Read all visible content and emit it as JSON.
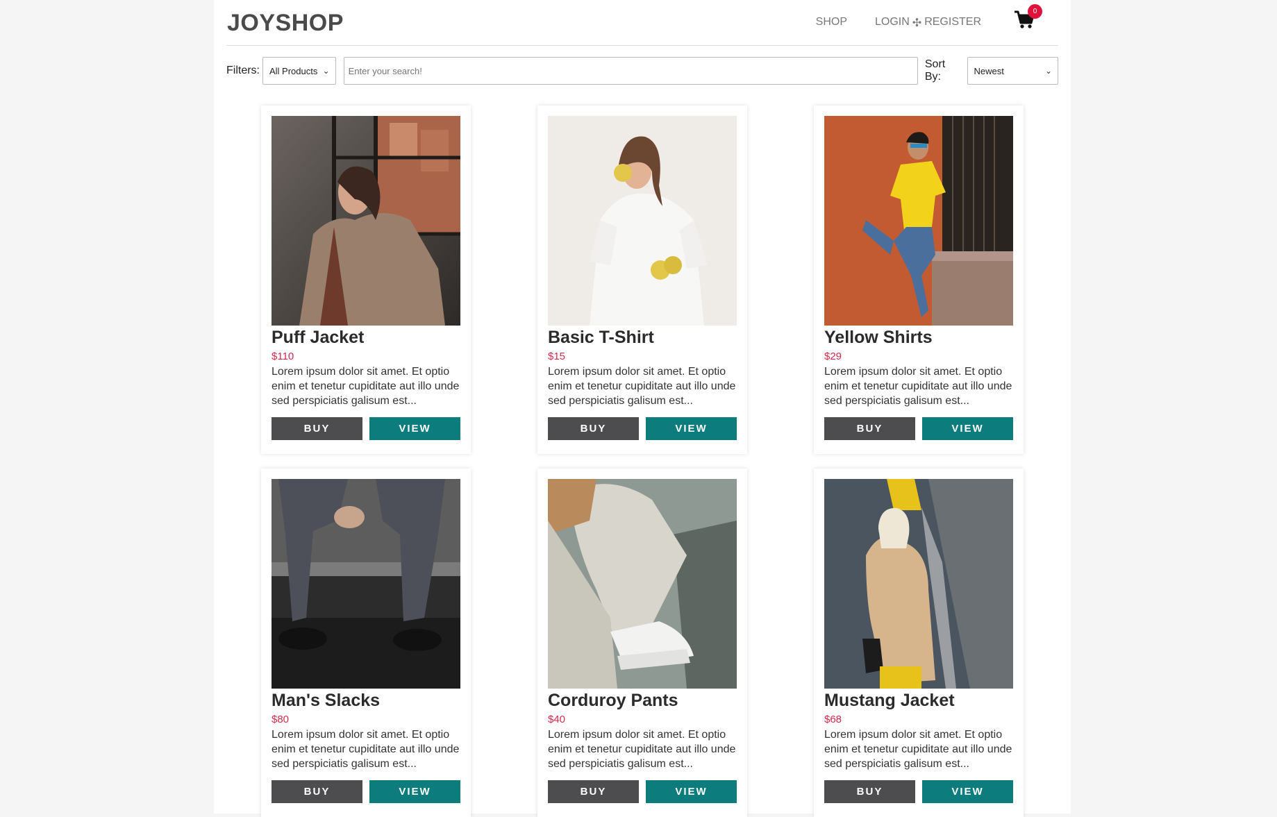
{
  "header": {
    "logo": "JOYSHOP",
    "nav": {
      "shop": "SHOP",
      "login": "LOGIN",
      "separator": "✣",
      "register": "REGISTER"
    },
    "cart": {
      "icon": "cart-icon",
      "count": "0"
    }
  },
  "toolbar": {
    "filters_label": "Filters:",
    "filter_value": "All Products",
    "search_placeholder": "Enter your search!",
    "sort_label": "Sort By:",
    "sort_value": "Newest"
  },
  "products": [
    {
      "name": "Puff Jacket",
      "price": "$110",
      "desc": "Lorem ipsum dolor sit amet. Et optio enim et tenetur cupiditate aut illo unde sed perspiciatis galisum est...",
      "buy": "BUY",
      "view": "VIEW"
    },
    {
      "name": "Basic T-Shirt",
      "price": "$15",
      "desc": "Lorem ipsum dolor sit amet. Et optio enim et tenetur cupiditate aut illo unde sed perspiciatis galisum est...",
      "buy": "BUY",
      "view": "VIEW"
    },
    {
      "name": "Yellow Shirts",
      "price": "$29",
      "desc": "Lorem ipsum dolor sit amet. Et optio enim et tenetur cupiditate aut illo unde sed perspiciatis galisum est...",
      "buy": "BUY",
      "view": "VIEW"
    },
    {
      "name": "Man's Slacks",
      "price": "$80",
      "desc": "Lorem ipsum dolor sit amet. Et optio enim et tenetur cupiditate aut illo unde sed perspiciatis galisum est...",
      "buy": "BUY",
      "view": "VIEW"
    },
    {
      "name": "Corduroy Pants",
      "price": "$40",
      "desc": "Lorem ipsum dolor sit amet. Et optio enim et tenetur cupiditate aut illo unde sed perspiciatis galisum est...",
      "buy": "BUY",
      "view": "VIEW"
    },
    {
      "name": "Mustang Jacket",
      "price": "$68",
      "desc": "Lorem ipsum dolor sit amet. Et optio enim et tenetur cupiditate aut illo unde sed perspiciatis galisum est...",
      "buy": "BUY",
      "view": "VIEW"
    }
  ],
  "colors": {
    "buy": "#4d4d4f",
    "view": "#0d7c7c",
    "price": "#d12a4b",
    "badge": "#e0123c"
  }
}
